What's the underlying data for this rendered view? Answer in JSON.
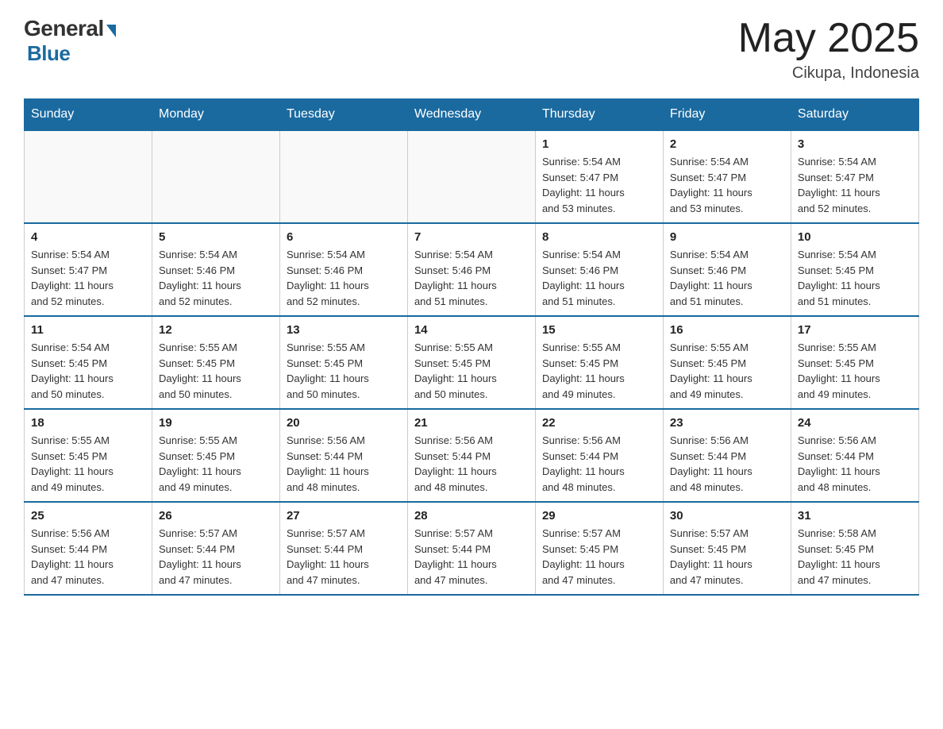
{
  "header": {
    "logo": {
      "general": "General",
      "blue": "Blue",
      "underline": "Blue"
    },
    "title": "May 2025",
    "subtitle": "Cikupa, Indonesia"
  },
  "calendar": {
    "days_of_week": [
      "Sunday",
      "Monday",
      "Tuesday",
      "Wednesday",
      "Thursday",
      "Friday",
      "Saturday"
    ],
    "weeks": [
      [
        {
          "day": "",
          "info": ""
        },
        {
          "day": "",
          "info": ""
        },
        {
          "day": "",
          "info": ""
        },
        {
          "day": "",
          "info": ""
        },
        {
          "day": "1",
          "info": "Sunrise: 5:54 AM\nSunset: 5:47 PM\nDaylight: 11 hours\nand 53 minutes."
        },
        {
          "day": "2",
          "info": "Sunrise: 5:54 AM\nSunset: 5:47 PM\nDaylight: 11 hours\nand 53 minutes."
        },
        {
          "day": "3",
          "info": "Sunrise: 5:54 AM\nSunset: 5:47 PM\nDaylight: 11 hours\nand 52 minutes."
        }
      ],
      [
        {
          "day": "4",
          "info": "Sunrise: 5:54 AM\nSunset: 5:47 PM\nDaylight: 11 hours\nand 52 minutes."
        },
        {
          "day": "5",
          "info": "Sunrise: 5:54 AM\nSunset: 5:46 PM\nDaylight: 11 hours\nand 52 minutes."
        },
        {
          "day": "6",
          "info": "Sunrise: 5:54 AM\nSunset: 5:46 PM\nDaylight: 11 hours\nand 52 minutes."
        },
        {
          "day": "7",
          "info": "Sunrise: 5:54 AM\nSunset: 5:46 PM\nDaylight: 11 hours\nand 51 minutes."
        },
        {
          "day": "8",
          "info": "Sunrise: 5:54 AM\nSunset: 5:46 PM\nDaylight: 11 hours\nand 51 minutes."
        },
        {
          "day": "9",
          "info": "Sunrise: 5:54 AM\nSunset: 5:46 PM\nDaylight: 11 hours\nand 51 minutes."
        },
        {
          "day": "10",
          "info": "Sunrise: 5:54 AM\nSunset: 5:45 PM\nDaylight: 11 hours\nand 51 minutes."
        }
      ],
      [
        {
          "day": "11",
          "info": "Sunrise: 5:54 AM\nSunset: 5:45 PM\nDaylight: 11 hours\nand 50 minutes."
        },
        {
          "day": "12",
          "info": "Sunrise: 5:55 AM\nSunset: 5:45 PM\nDaylight: 11 hours\nand 50 minutes."
        },
        {
          "day": "13",
          "info": "Sunrise: 5:55 AM\nSunset: 5:45 PM\nDaylight: 11 hours\nand 50 minutes."
        },
        {
          "day": "14",
          "info": "Sunrise: 5:55 AM\nSunset: 5:45 PM\nDaylight: 11 hours\nand 50 minutes."
        },
        {
          "day": "15",
          "info": "Sunrise: 5:55 AM\nSunset: 5:45 PM\nDaylight: 11 hours\nand 49 minutes."
        },
        {
          "day": "16",
          "info": "Sunrise: 5:55 AM\nSunset: 5:45 PM\nDaylight: 11 hours\nand 49 minutes."
        },
        {
          "day": "17",
          "info": "Sunrise: 5:55 AM\nSunset: 5:45 PM\nDaylight: 11 hours\nand 49 minutes."
        }
      ],
      [
        {
          "day": "18",
          "info": "Sunrise: 5:55 AM\nSunset: 5:45 PM\nDaylight: 11 hours\nand 49 minutes."
        },
        {
          "day": "19",
          "info": "Sunrise: 5:55 AM\nSunset: 5:45 PM\nDaylight: 11 hours\nand 49 minutes."
        },
        {
          "day": "20",
          "info": "Sunrise: 5:56 AM\nSunset: 5:44 PM\nDaylight: 11 hours\nand 48 minutes."
        },
        {
          "day": "21",
          "info": "Sunrise: 5:56 AM\nSunset: 5:44 PM\nDaylight: 11 hours\nand 48 minutes."
        },
        {
          "day": "22",
          "info": "Sunrise: 5:56 AM\nSunset: 5:44 PM\nDaylight: 11 hours\nand 48 minutes."
        },
        {
          "day": "23",
          "info": "Sunrise: 5:56 AM\nSunset: 5:44 PM\nDaylight: 11 hours\nand 48 minutes."
        },
        {
          "day": "24",
          "info": "Sunrise: 5:56 AM\nSunset: 5:44 PM\nDaylight: 11 hours\nand 48 minutes."
        }
      ],
      [
        {
          "day": "25",
          "info": "Sunrise: 5:56 AM\nSunset: 5:44 PM\nDaylight: 11 hours\nand 47 minutes."
        },
        {
          "day": "26",
          "info": "Sunrise: 5:57 AM\nSunset: 5:44 PM\nDaylight: 11 hours\nand 47 minutes."
        },
        {
          "day": "27",
          "info": "Sunrise: 5:57 AM\nSunset: 5:44 PM\nDaylight: 11 hours\nand 47 minutes."
        },
        {
          "day": "28",
          "info": "Sunrise: 5:57 AM\nSunset: 5:44 PM\nDaylight: 11 hours\nand 47 minutes."
        },
        {
          "day": "29",
          "info": "Sunrise: 5:57 AM\nSunset: 5:45 PM\nDaylight: 11 hours\nand 47 minutes."
        },
        {
          "day": "30",
          "info": "Sunrise: 5:57 AM\nSunset: 5:45 PM\nDaylight: 11 hours\nand 47 minutes."
        },
        {
          "day": "31",
          "info": "Sunrise: 5:58 AM\nSunset: 5:45 PM\nDaylight: 11 hours\nand 47 minutes."
        }
      ]
    ]
  }
}
